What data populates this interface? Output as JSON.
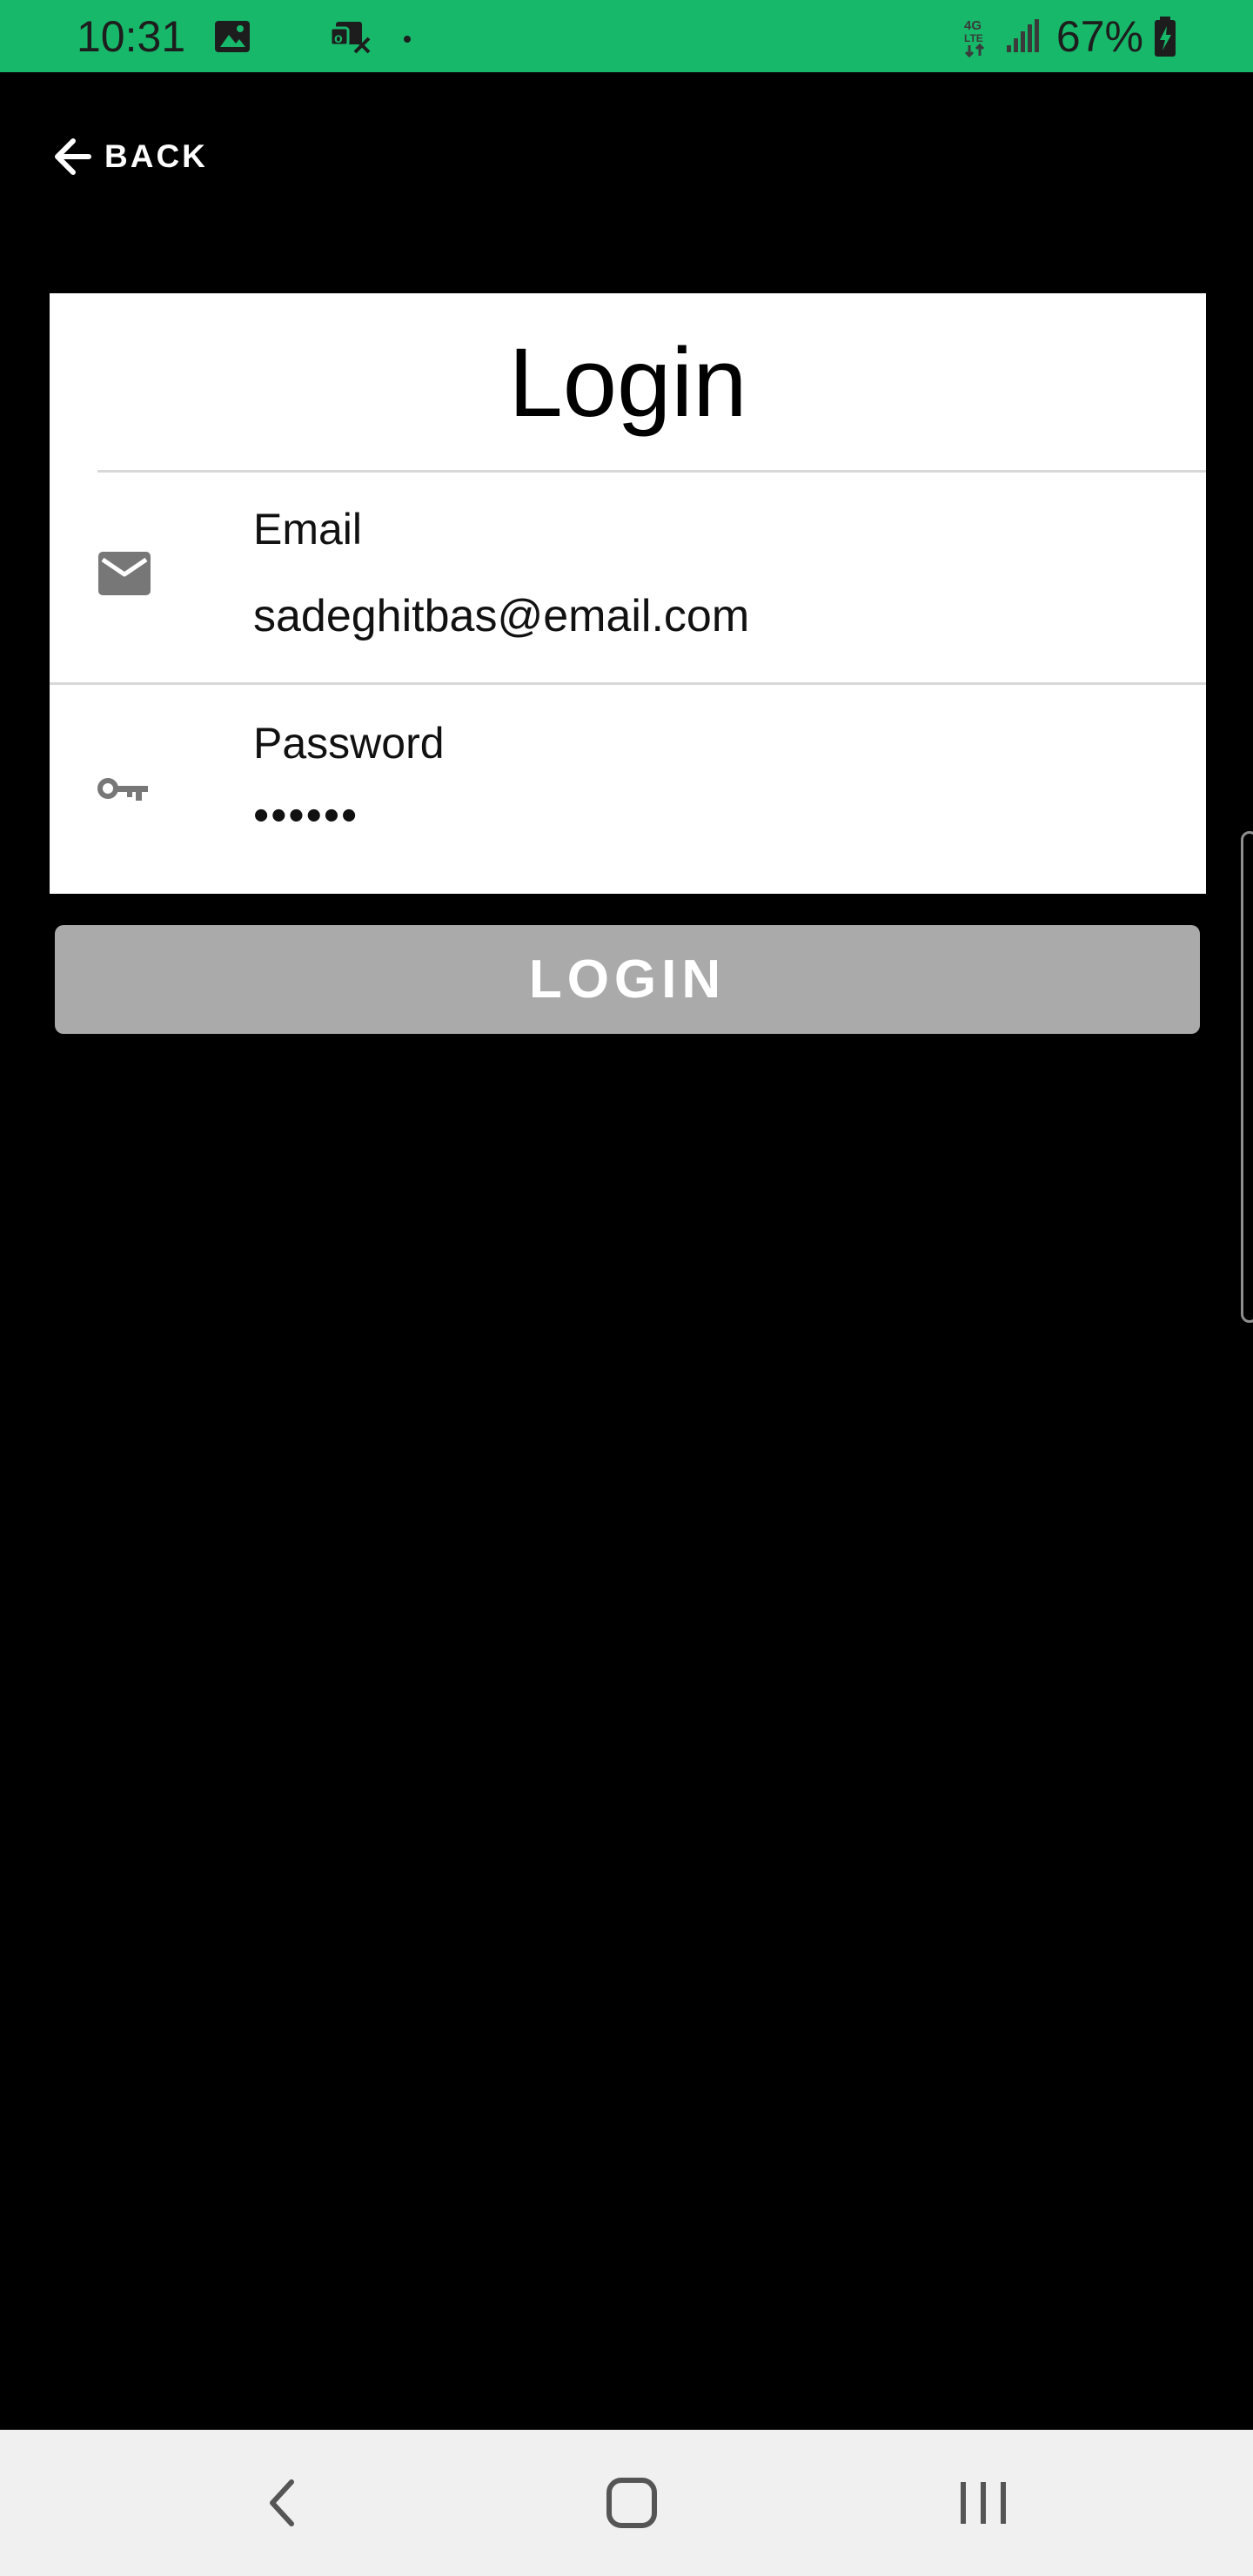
{
  "status_bar": {
    "time": "10:31",
    "battery": "67%",
    "background_color": "#17b86a",
    "icons": [
      "image-icon",
      "notification-icon",
      "dot-icon",
      "network-4g-icon",
      "signal-icon",
      "battery-icon"
    ]
  },
  "header": {
    "back_label": "BACK"
  },
  "login_card": {
    "title": "Login",
    "email": {
      "label": "Email",
      "value": "sadeghitbas@email.com",
      "icon": "mail-icon"
    },
    "password": {
      "label": "Password",
      "value": "••••••",
      "icon": "key-icon"
    }
  },
  "login_button": {
    "label": "LOGIN",
    "color": "#aaaaaa"
  },
  "nav_bar": {
    "icons": [
      "back-nav-icon",
      "home-nav-icon",
      "recents-nav-icon"
    ]
  }
}
